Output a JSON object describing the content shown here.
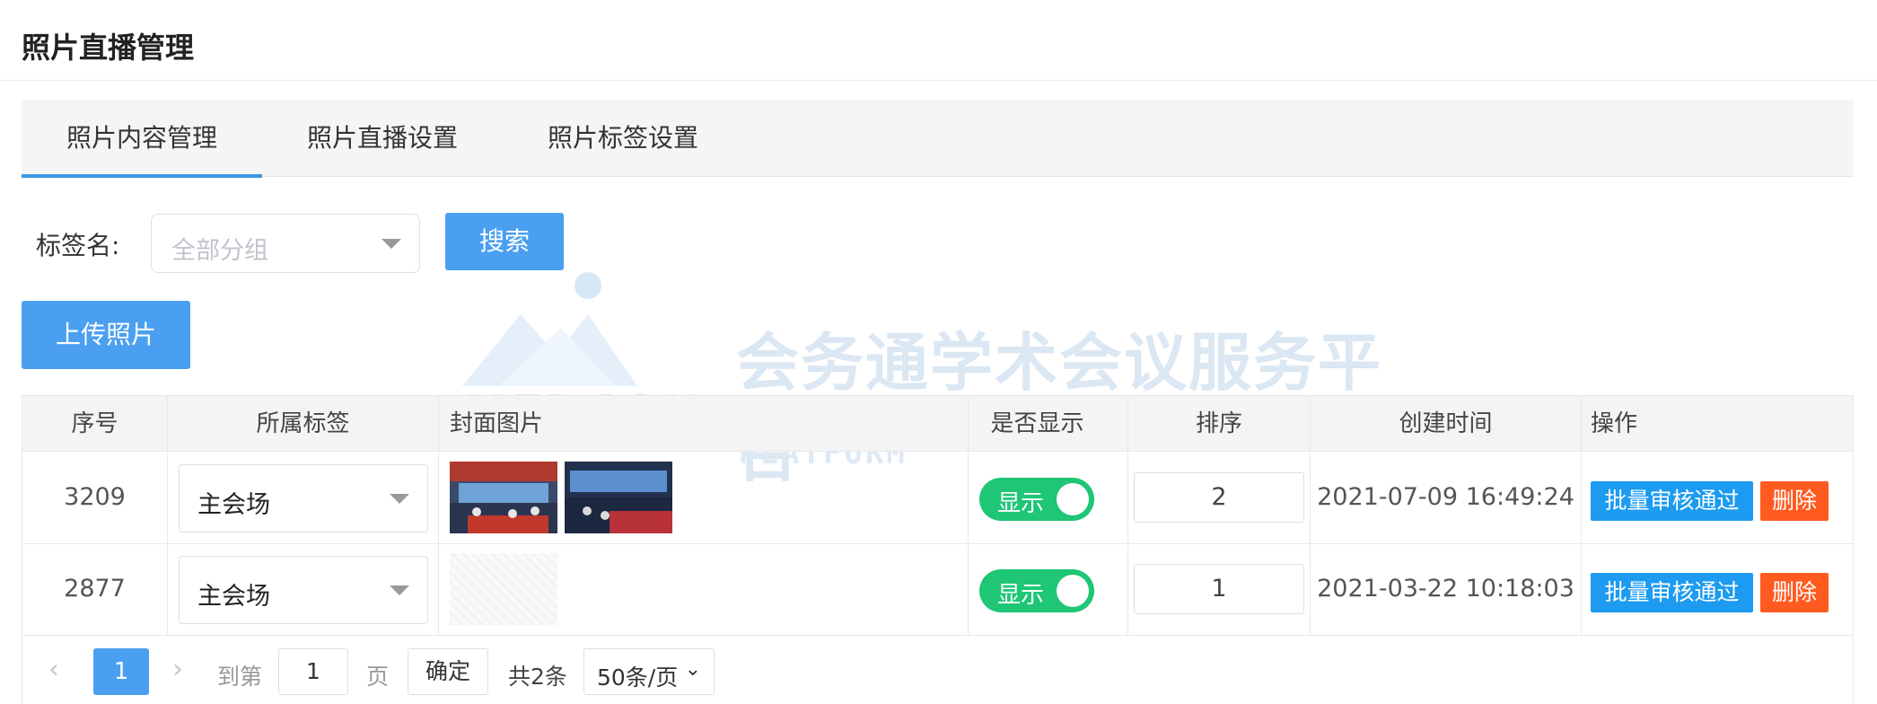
{
  "page": {
    "title": "照片直播管理"
  },
  "tabs": [
    {
      "label": "照片内容管理",
      "active": true
    },
    {
      "label": "照片直播设置",
      "active": false
    },
    {
      "label": "照片标签设置",
      "active": false
    }
  ],
  "filter": {
    "label": "标签名:",
    "select_placeholder": "全部分组",
    "search_label": "搜索"
  },
  "upload_label": "上传照片",
  "watermark": {
    "logo_text": "MEDCON",
    "title": "会务通学术会议服务平台",
    "subtitle": "MEDCON CONFERENCE SERVICE PLATFORM"
  },
  "table": {
    "columns": [
      "序号",
      "所属标签",
      "封面图片",
      "是否显示",
      "排序",
      "创建时间",
      "操作"
    ],
    "rows": [
      {
        "id": "3209",
        "tag": "主会场",
        "has_images": true,
        "show_label": "显示",
        "order": "2",
        "created": "2021-07-09 16:49:24",
        "approve_label": "批量审核通过",
        "delete_label": "删除"
      },
      {
        "id": "2877",
        "tag": "主会场",
        "has_images": false,
        "show_label": "显示",
        "order": "1",
        "created": "2021-03-22 10:18:03",
        "approve_label": "批量审核通过",
        "delete_label": "删除"
      }
    ]
  },
  "pagination": {
    "prev_icon": "chevron-left-icon",
    "next_icon": "chevron-right-icon",
    "current_page": "1",
    "goto_prefix": "到第",
    "goto_value": "1",
    "goto_suffix": "页",
    "confirm_label": "确定",
    "total_text": "共2条",
    "page_size": "50条/页"
  },
  "colors": {
    "primary": "#4a9ff0",
    "switch_on": "#1ec676",
    "approve": "#1c9bf0",
    "delete": "#ff5a1f"
  }
}
